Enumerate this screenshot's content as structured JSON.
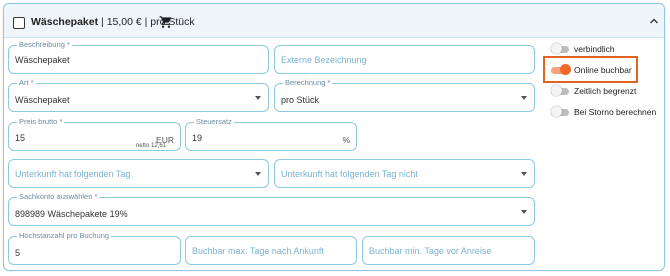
{
  "header": {
    "title": "Wäschepaket",
    "price_unit": "| 15,00 € | pro Stück",
    "icons": {
      "checkbox": "checkbox-empty-icon",
      "cart": "cart-icon",
      "collapse": "chevron-up-icon"
    }
  },
  "fields": {
    "beschreibung": {
      "label": "Beschreibung *",
      "value": "Wäschepaket"
    },
    "externe": {
      "placeholder": "Externe Bezeichnung"
    },
    "art": {
      "label": "Art *",
      "value": "Wäschepaket"
    },
    "berechnung": {
      "label": "Berechnung *",
      "value": "pro Stück"
    },
    "preis": {
      "label": "Preis brutto *",
      "value": "15",
      "suffix": "EUR",
      "hint": "netto 12,61"
    },
    "steuersatz": {
      "label": "Steuersatz",
      "value": "19",
      "suffix": "%"
    },
    "tag": {
      "placeholder": "Unterkunft hat folgenden Tag"
    },
    "tag_nicht": {
      "placeholder": "Unterkunft hat folgenden Tag nicht"
    },
    "sachkonto": {
      "label": "Sachkonto auswählen *",
      "value": "898989 Wäschepakete 19%"
    },
    "hoechstanzahl": {
      "label": "Höchstanzahl pro Buchung",
      "value": "5"
    },
    "max_tage": {
      "placeholder": "Buchbar max. Tage nach Ankunft"
    },
    "min_tage": {
      "placeholder": "Buchbar min. Tage vor Anreise"
    }
  },
  "toggles": [
    {
      "label": "verbindlich",
      "on": false
    },
    {
      "label": "Online buchbar",
      "on": true
    },
    {
      "label": "Zeitlich begrenzt",
      "on": false
    },
    {
      "label": "Bei Storno berechnen",
      "on": false
    }
  ],
  "colors": {
    "accent": "#ef6a2a",
    "highlight_border": "#e2621f",
    "field_border": "#8ec7e0",
    "header_bg": "#eef6fb"
  }
}
